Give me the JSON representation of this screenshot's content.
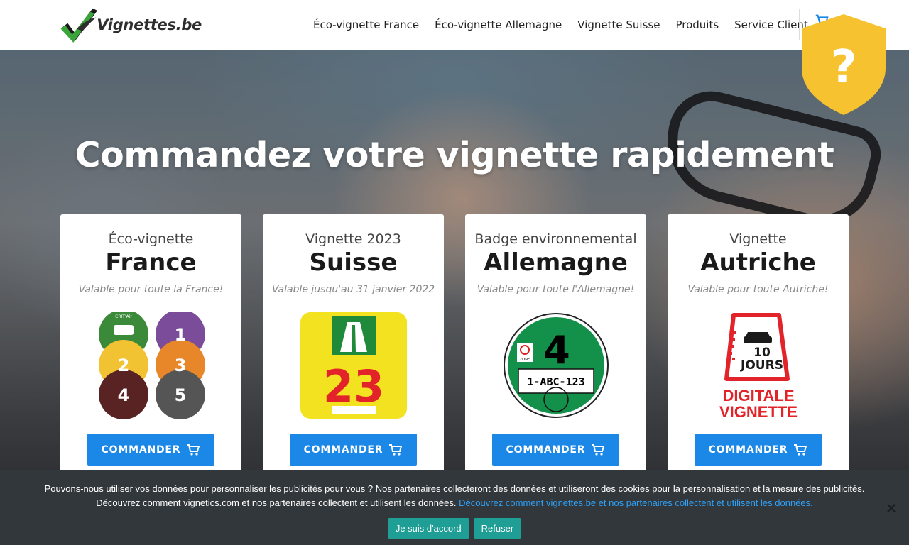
{
  "header": {
    "logo_text": "Vignettes.be",
    "nav": [
      {
        "label": "Éco-vignette France"
      },
      {
        "label": "Éco-vignette Allemagne"
      },
      {
        "label": "Vignette Suisse"
      },
      {
        "label": "Produits"
      },
      {
        "label": "Service Client"
      }
    ]
  },
  "hero": {
    "title": "Commandez votre vignette rapidement"
  },
  "cards": [
    {
      "subtitle": "Éco-vignette",
      "title": "France",
      "validity": "Valable pour toute la France!",
      "button": "COMMANDER",
      "image": {
        "labels": [
          "CRIT'Air",
          "1",
          "2",
          "3",
          "4",
          "5"
        ]
      }
    },
    {
      "subtitle": "Vignette 2023",
      "title": "Suisse",
      "validity": "Valable jusqu'au 31 janvier 2022",
      "button": "COMMANDER",
      "image": {
        "number": "23"
      }
    },
    {
      "subtitle": "Badge environnemental",
      "title": "Allemagne",
      "validity": "Valable pour toute l'Allemagne!",
      "button": "COMMANDER",
      "image": {
        "number": "4",
        "plate": "1-ABC-123",
        "zone": "ZONE"
      }
    },
    {
      "subtitle": "Vignette",
      "title": "Autriche",
      "validity": "Valable pour toute Autriche!",
      "button": "COMMANDER",
      "image": {
        "days_line1": "10",
        "days_line2": "JOURS",
        "caption_line1": "DIGITALE",
        "caption_line2": "VIGNETTE"
      }
    }
  ],
  "shield": {
    "symbol": "?"
  },
  "cookie": {
    "text_line1": "Pouvons-nous utiliser vos données pour personnaliser les publicités pour vous ? Nos partenaires collecteront des données et utiliseront des cookies pour la personnalisation et la mesure des publicités.",
    "text_line2": "Découvrez comment vignetics.com et nos partenaires collectent et utilisent les données.",
    "link": "Découvrez comment vignettes.be et nos partenaires collectent et utilisent les données.",
    "accept": "Je suis d'accord",
    "refuse": "Refuser"
  },
  "colors": {
    "accent": "#1b87e6",
    "cookie_bg": "#32373c",
    "cookie_button": "#1f9e96",
    "cookie_link": "#2ea2f8",
    "shield": "#f7c22f"
  },
  "icons": [
    "checkmark-logo-icon",
    "cart-icon",
    "shield-question-icon",
    "close-icon"
  ]
}
